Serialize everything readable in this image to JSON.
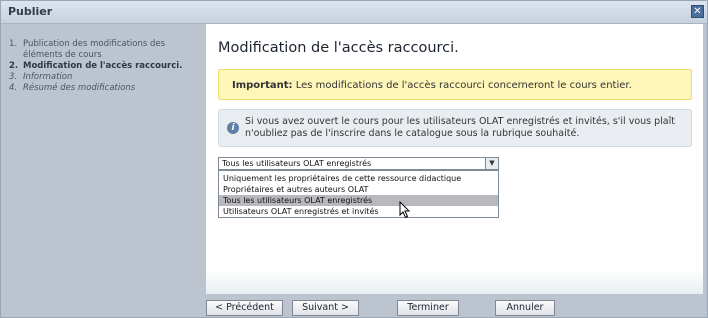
{
  "window": {
    "title": "Publier",
    "close_glyph": "✕"
  },
  "sidebar": {
    "steps": [
      {
        "num": "1.",
        "label": "Publication des modifications des éléments de cours"
      },
      {
        "num": "2.",
        "label": "Modification de l'accès raccourci."
      },
      {
        "num": "3.",
        "label": "Information"
      },
      {
        "num": "4.",
        "label": "Résumé des modifications"
      }
    ]
  },
  "main": {
    "title": "Modification de l'accès raccourci.",
    "important": {
      "label": "Important:",
      "text": " Les modifications de l'accès raccourci concerneront le cours entier."
    },
    "info": {
      "icon": "info-icon",
      "text": "Si vous avez ouvert le cours pour les utilisateurs OLAT enregistrés et invités, s'il vous plaît n'oubliez pas de l'inscrire dans le catalogue sous la rubrique souhaité."
    },
    "access_select": {
      "value": "Tous les utilisateurs OLAT enregistrés",
      "options": [
        "Uniquement les propriétaires de cette ressource didactique",
        "Propriétaires et autres auteurs OLAT",
        "Tous les utilisateurs OLAT enregistrés",
        "Utilisateurs OLAT enregistrés et invités"
      ],
      "highlighted_index": 2
    }
  },
  "footer": {
    "prev_label": "< Précédent",
    "next_label": "Suivant >",
    "finish_label": "Terminer",
    "cancel_label": "Annuler"
  }
}
